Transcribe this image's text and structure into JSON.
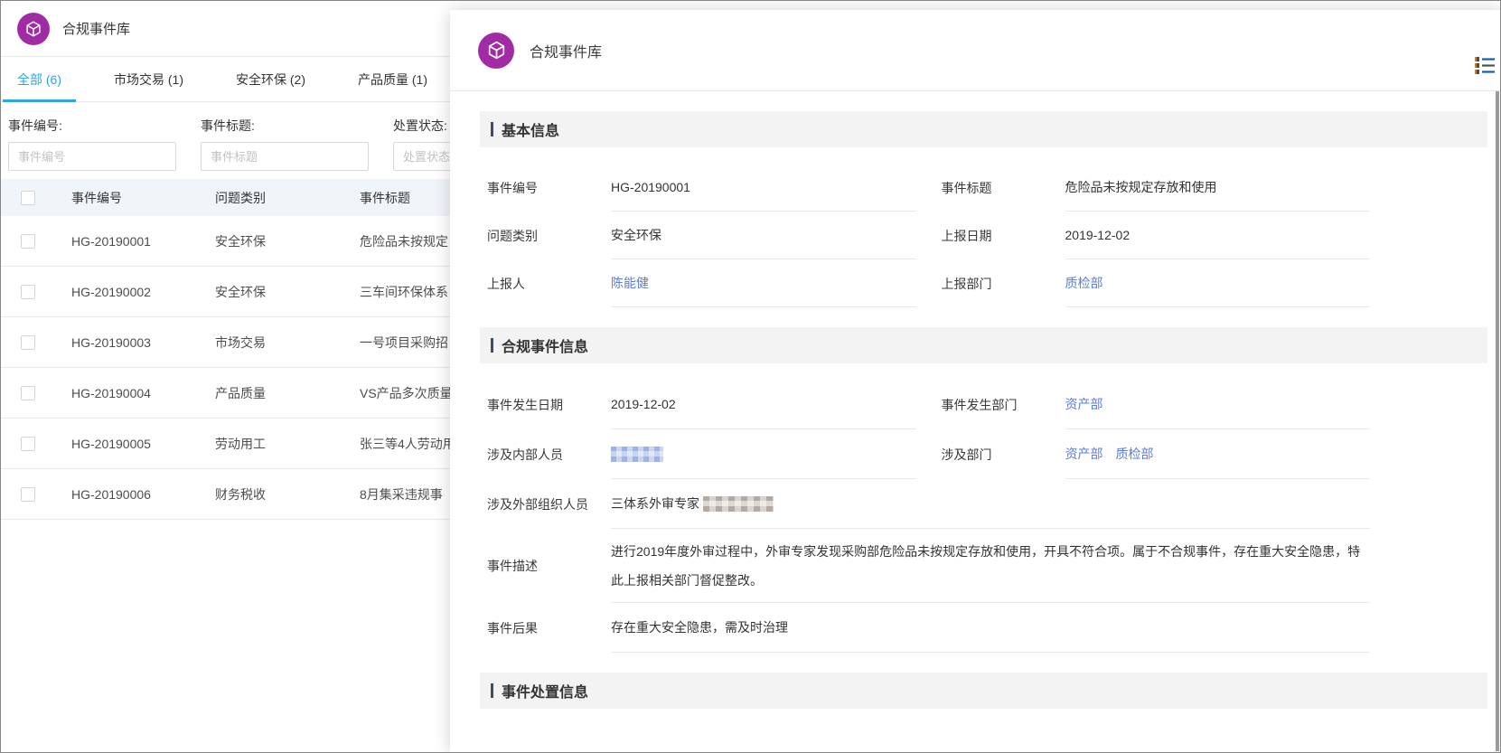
{
  "colors": {
    "brand_purple": "#a12ba5",
    "active_tab_blue": "#2aa7e1",
    "link_blue": "#5b7ce0"
  },
  "background": {
    "header": {
      "title": "合规事件库"
    },
    "tabs": [
      {
        "label": "全部 (6)",
        "active": true
      },
      {
        "label": "市场交易 (1)",
        "active": false
      },
      {
        "label": "安全环保 (2)",
        "active": false
      },
      {
        "label": "产品质量 (1)",
        "active": false
      }
    ],
    "filters": [
      {
        "label": "事件编号:",
        "placeholder": "事件编号"
      },
      {
        "label": "事件标题:",
        "placeholder": "事件标题"
      },
      {
        "label": "处置状态:",
        "placeholder": "处置状态"
      }
    ],
    "table": {
      "columns": [
        "事件编号",
        "问题类别",
        "事件标题"
      ],
      "rows": [
        {
          "id": "HG-20190001",
          "category": "安全环保",
          "title": "危险品未按规定"
        },
        {
          "id": "HG-20190002",
          "category": "安全环保",
          "title": "三车间环保体系"
        },
        {
          "id": "HG-20190003",
          "category": "市场交易",
          "title": "一号项目采购招"
        },
        {
          "id": "HG-20190004",
          "category": "产品质量",
          "title": "VS产品多次质量"
        },
        {
          "id": "HG-20190005",
          "category": "劳动用工",
          "title": "张三等4人劳动用"
        },
        {
          "id": "HG-20190006",
          "category": "财务税收",
          "title": "8月集采违规事"
        }
      ]
    }
  },
  "panel": {
    "header": {
      "title": "合规事件库"
    },
    "basic": {
      "title": "基本信息",
      "event_id": {
        "label": "事件编号",
        "value": "HG-20190001"
      },
      "event_title": {
        "label": "事件标题",
        "value": "危险品未按规定存放和使用"
      },
      "category": {
        "label": "问题类别",
        "value": "安全环保"
      },
      "report_date": {
        "label": "上报日期",
        "value": "2019-12-02"
      },
      "reporter": {
        "label": "上报人",
        "value": "陈能健"
      },
      "report_dept": {
        "label": "上报部门",
        "value": "质检部"
      }
    },
    "compliance": {
      "title": "合规事件信息",
      "occur_date": {
        "label": "事件发生日期",
        "value": "2019-12-02"
      },
      "occur_dept": {
        "label": "事件发生部门",
        "value": "资产部"
      },
      "internal_people": {
        "label": "涉及内部人员"
      },
      "involved_depts": {
        "label": "涉及部门",
        "value1": "资产部",
        "value2": "质检部"
      },
      "external_people": {
        "label": "涉及外部组织人员",
        "value": "三体系外审专家"
      },
      "description": {
        "label": "事件描述",
        "value": "进行2019年度外审过程中，外审专家发现采购部危险品未按规定存放和使用，开具不符合项。属于不合规事件，存在重大安全隐患，特此上报相关部门督促整改。"
      },
      "consequence": {
        "label": "事件后果",
        "value": "存在重大安全隐患，需及时治理"
      }
    },
    "disposal": {
      "title": "事件处置信息"
    }
  }
}
